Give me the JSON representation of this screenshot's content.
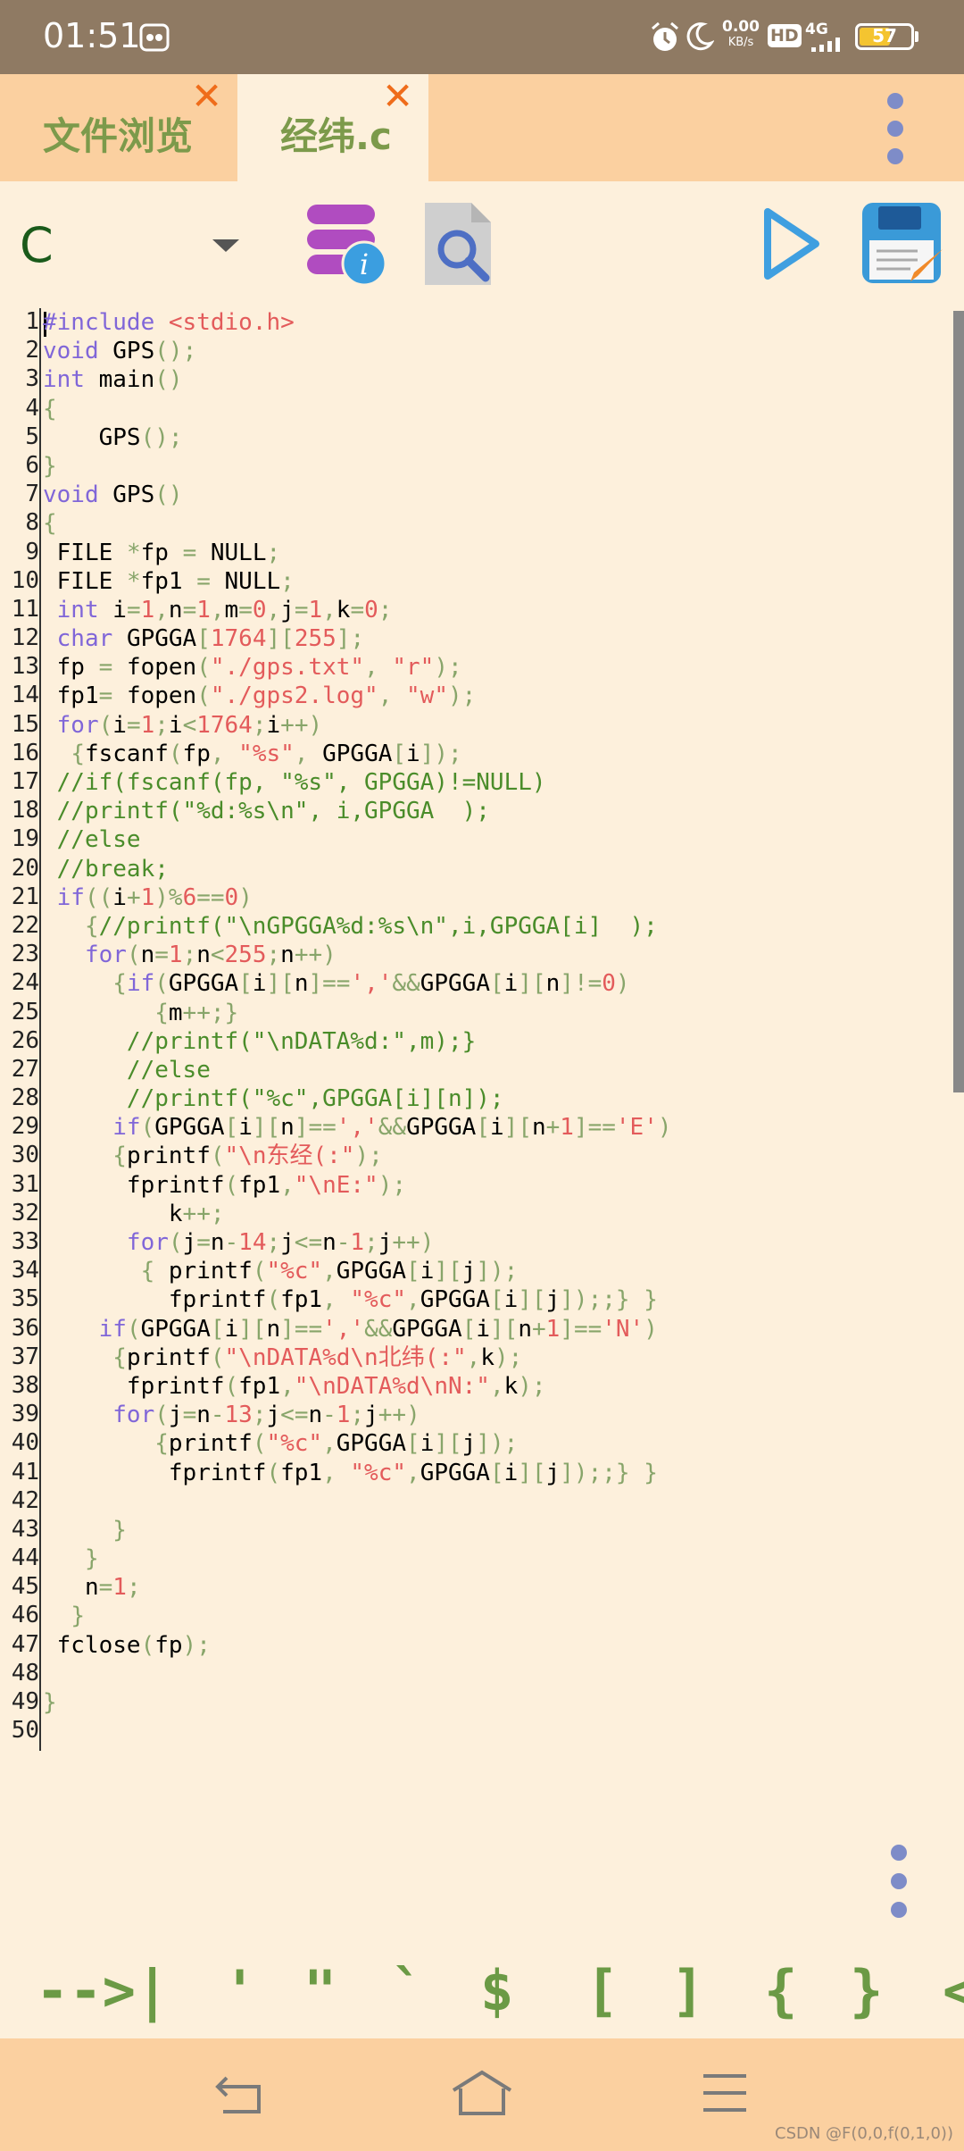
{
  "status_bar": {
    "time": "01:51",
    "net_speed_value": "0.00",
    "net_speed_unit": "KB/s",
    "hd": "HD",
    "network": "4G",
    "battery": "57"
  },
  "tabs": [
    {
      "label": "文件浏览",
      "close": "✕"
    },
    {
      "label": "经纬.c",
      "close": "✕"
    }
  ],
  "toolbar": {
    "language": "C"
  },
  "editor": {
    "line_numbers": [
      "1",
      "2",
      "3",
      "4",
      "5",
      "6",
      "7",
      "8",
      "9",
      "10",
      "11",
      "12",
      "13",
      "14",
      "15",
      "16",
      "17",
      "18",
      "19",
      "20",
      "21",
      "22",
      "23",
      "24",
      "25",
      "26",
      "27",
      "28",
      "29",
      "30",
      "31",
      "32",
      "33",
      "34",
      "35",
      "36",
      "37",
      "38",
      "39",
      "40",
      "41",
      "42",
      "43",
      "44",
      "45",
      "46",
      "47",
      "48",
      "49",
      "50"
    ],
    "lines": [
      "#include <stdio.h>",
      "void GPS();",
      "int main()",
      "{",
      "    GPS();",
      "}",
      "void GPS()",
      "{",
      " FILE *fp = NULL;",
      " FILE *fp1 = NULL;",
      " int i=1,n=1,m=0,j=1,k=0;",
      " char GPGGA[1764][255];",
      " fp = fopen(\"./gps.txt\", \"r\");",
      " fp1= fopen(\"./gps2.log\", \"w\");",
      " for(i=1;i<1764;i++)",
      "  {fscanf(fp, \"%s\", GPGGA[i]);",
      " //if(fscanf(fp, \"%s\", GPGGA)!=NULL)",
      " //printf(\"%d:%s\\n\", i,GPGGA  );",
      " //else",
      " //break;",
      " if((i+1)%6==0)",
      "   {//printf(\"\\nGPGGA%d:%s\\n\",i,GPGGA[i]  );",
      "   for(n=1;n<255;n++)",
      "     {if(GPGGA[i][n]==','&&GPGGA[i][n]!=0)",
      "        {m++;}",
      "      //printf(\"\\nDATA%d:\",m);}",
      "      //else",
      "      //printf(\"%c\",GPGGA[i][n]);",
      "     if(GPGGA[i][n]==','&&GPGGA[i][n+1]=='E')",
      "     {printf(\"\\n东经(:\");",
      "      fprintf(fp1,\"\\nE:\");",
      "         k++;",
      "      for(j=n-14;j<=n-1;j++)",
      "       { printf(\"%c\",GPGGA[i][j]);",
      "         fprintf(fp1, \"%c\",GPGGA[i][j]);;} }",
      "    if(GPGGA[i][n]==','&&GPGGA[i][n+1]=='N')",
      "     {printf(\"\\nDATA%d\\n北纬(:\",k);",
      "      fprintf(fp1,\"\\nDATA%d\\nN:\",k);",
      "     for(j=n-13;j<=n-1;j++)",
      "        {printf(\"%c\",GPGGA[i][j]);",
      "         fprintf(fp1, \"%c\",GPGGA[i][j]);;} }",
      "",
      "     }",
      "   }",
      "   n=1;",
      "  }",
      " fclose(fp);",
      "",
      "}",
      ""
    ]
  },
  "symbols": [
    "-->|",
    "'",
    "\"",
    "`",
    "$",
    "[",
    "]",
    "{",
    "}",
    "<"
  ],
  "watermark": "CSDN @F(0,0,f(0,1,0))"
}
